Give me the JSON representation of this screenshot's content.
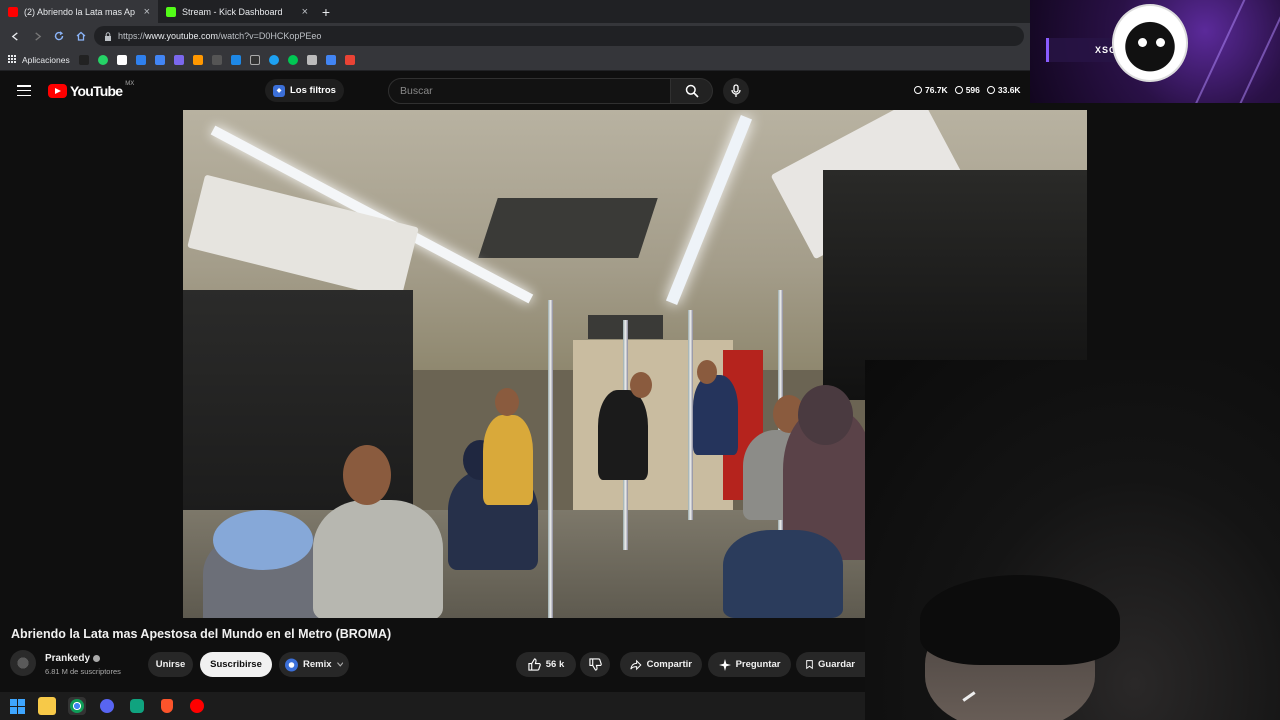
{
  "browser": {
    "tabs": [
      {
        "label": "(2) Abriendo la Lata mas Ap",
        "favicon_color": "#ff0000",
        "active": true
      },
      {
        "label": "Stream - Kick Dashboard",
        "favicon_color": "#53fc18",
        "active": false
      }
    ],
    "new_tab_glyph": "+",
    "close_glyph": "×",
    "url_prefix": "https://",
    "url_host": "www.youtube.com",
    "url_path": "/watch?v=D0HCKopPEeo",
    "bookmarks_label": "Aplicaciones",
    "bookmark_colors": [
      "#222222",
      "#25d366",
      "#ffffff",
      "#2f80ed",
      "#4285f4",
      "#7b68ee",
      "#ff9800",
      "#cccccc",
      "#1e88e5",
      "#ffffff",
      "#1da1f2",
      "#00c853",
      "#bbbbbb",
      "#4285f4",
      "#ea4335"
    ]
  },
  "overlay": {
    "name": "XSOY"
  },
  "youtube": {
    "logo_text": "YouTube",
    "country_code": "MX",
    "filters_label": "Los filtros",
    "search_placeholder": "Buscar",
    "stats": [
      "76.7K",
      "596",
      "33.6K"
    ],
    "video_title": "Abriendo la Lata mas Apestosa del Mundo en el Metro (BROMA)",
    "channel": "Prankedy",
    "subscribers": "6.81 M de suscriptores",
    "join_label": "Unirse",
    "subscribe_label": "Suscribirse",
    "remix_label": "Remix",
    "likes": "56 k",
    "share_label": "Compartir",
    "ask_label": "Preguntar",
    "save_label": "Guardar"
  },
  "colors": {
    "yt_red": "#ff0000",
    "background": "#0f0f0f",
    "accent_blue": "#3ea6ff"
  }
}
